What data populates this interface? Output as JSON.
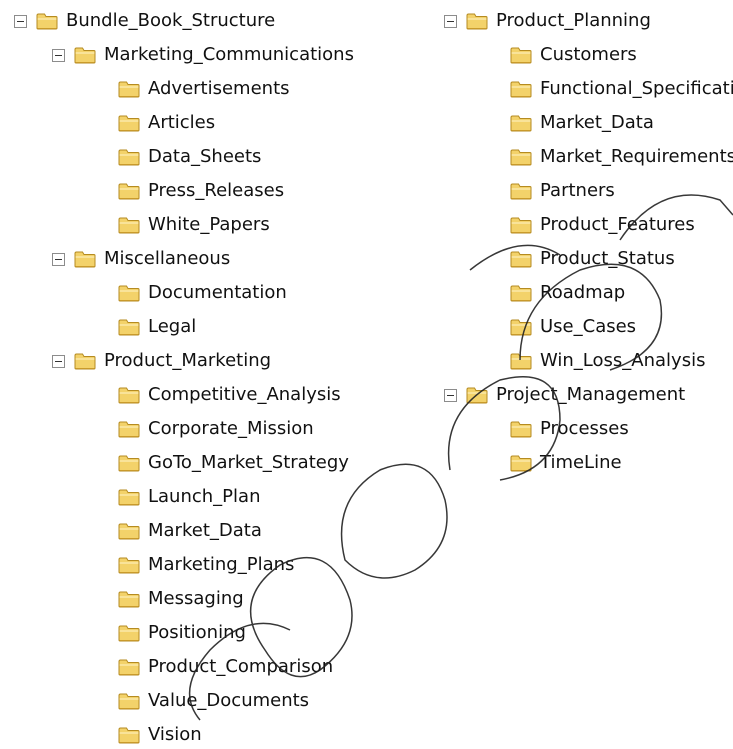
{
  "colors": {
    "folder_fill": "#f3d26a",
    "folder_stroke": "#b58b21",
    "toggle_border": "#8c8c8c"
  },
  "icons": {
    "toggle": "minus-box-icon",
    "folder": "folder-icon"
  },
  "left_tree": {
    "root": {
      "label": "Bundle_Book_Structure",
      "children": [
        {
          "label": "Marketing_Communications",
          "children": [
            "Advertisements",
            "Articles",
            "Data_Sheets",
            "Press_Releases",
            "White_Papers"
          ]
        },
        {
          "label": "Miscellaneous",
          "children": [
            "Documentation",
            "Legal"
          ]
        },
        {
          "label": "Product_Marketing",
          "children": [
            "Competitive_Analysis",
            "Corporate_Mission",
            "GoTo_Market_Strategy",
            "Launch_Plan",
            "Market_Data",
            "Marketing_Plans",
            "Messaging",
            "Positioning",
            "Product_Comparison",
            "Value_Documents",
            "Vision"
          ]
        }
      ]
    }
  },
  "right_tree": {
    "product_planning": {
      "label": "Product_Planning",
      "children": [
        "Customers",
        "Functional_Specifications",
        "Market_Data",
        "Market_Requirements",
        "Partners",
        "Product_Features",
        "Product_Status",
        "Roadmap",
        "Use_Cases",
        "Win_Loss_Analysis"
      ]
    },
    "project_management": {
      "label": "Project_Management",
      "children": [
        "Processes",
        "TimeLine"
      ]
    }
  }
}
